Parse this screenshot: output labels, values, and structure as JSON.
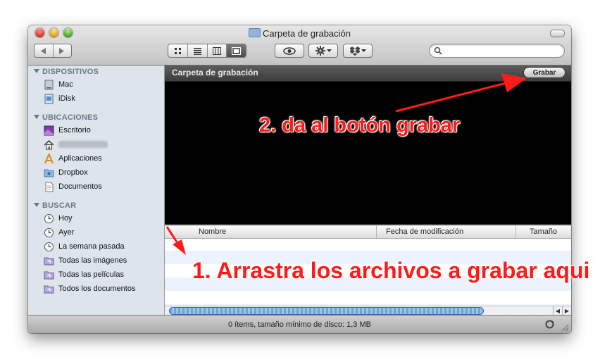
{
  "window": {
    "title": "Carpeta de grabación"
  },
  "toolbar": {
    "view_buttons": [
      "icon-view-icon",
      "list-view-icon",
      "column-view-icon",
      "coverflow-view-icon"
    ],
    "search_placeholder": ""
  },
  "sidebar": {
    "sections": [
      {
        "label": "DISPOSITIVOS",
        "items": [
          {
            "label": "Mac",
            "icon": "hard-drive-icon"
          },
          {
            "label": "iDisk",
            "icon": "idisk-icon"
          }
        ]
      },
      {
        "label": "UBICACIONES",
        "items": [
          {
            "label": "Escritorio",
            "icon": "desktop-icon"
          },
          {
            "label": "",
            "icon": "home-icon"
          },
          {
            "label": "Aplicaciones",
            "icon": "applications-icon"
          },
          {
            "label": "Dropbox",
            "icon": "folder-icon"
          },
          {
            "label": "Documentos",
            "icon": "document-icon"
          }
        ]
      },
      {
        "label": "BUSCAR",
        "items": [
          {
            "label": "Hoy",
            "icon": "clock-icon"
          },
          {
            "label": "Ayer",
            "icon": "clock-icon"
          },
          {
            "label": "La semana pasada",
            "icon": "clock-icon"
          },
          {
            "label": "Todas las imágenes",
            "icon": "smart-folder-icon"
          },
          {
            "label": "Todas las películas",
            "icon": "smart-folder-icon"
          },
          {
            "label": "Todos los documentos",
            "icon": "smart-folder-icon"
          }
        ]
      }
    ]
  },
  "burn_bar": {
    "title": "Carpeta de grabación",
    "button_label": "Grabar"
  },
  "columns": [
    "Nombre",
    "Fecha de modificación",
    "Tamaño"
  ],
  "status": "0 ítems, tamaño mínimo de disco: 1,3 MB",
  "annotations": {
    "step2": "2. da al botón grabar",
    "step1": "1. Arrastra los  archivos a grabar aqui",
    "color": "#ff1a1a"
  }
}
